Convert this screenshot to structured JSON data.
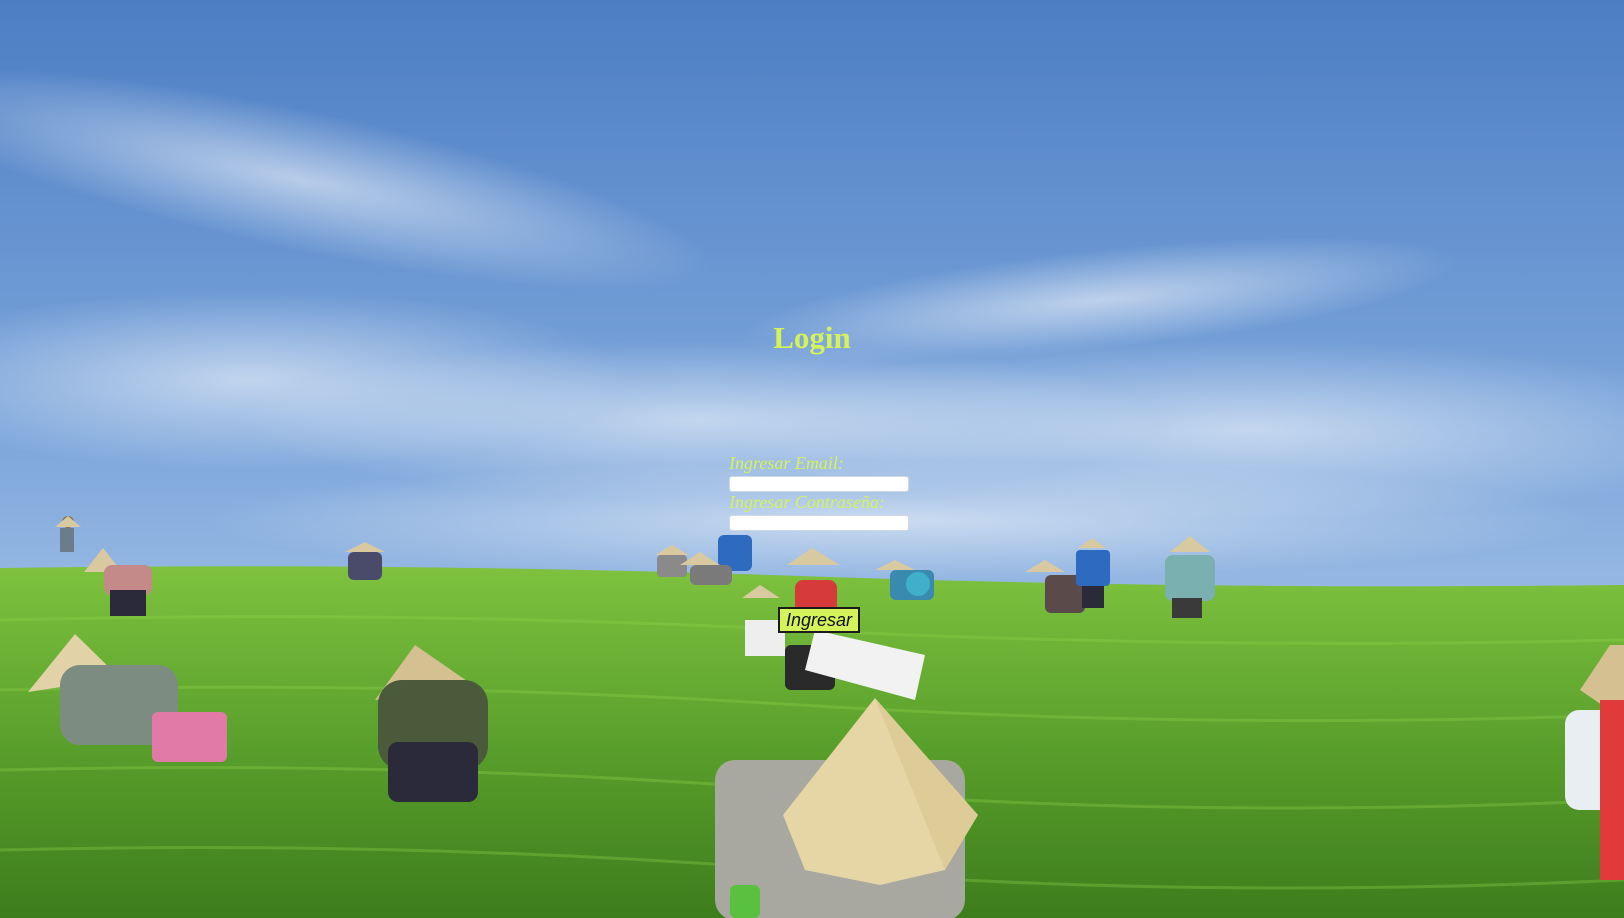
{
  "login": {
    "title": "Login",
    "email_label": "Ingresar Email:",
    "email_value": "",
    "password_label": "Ingresar Contraseña:",
    "password_value": "",
    "submit_label": "Ingresar"
  },
  "colors": {
    "accent": "#d4f25a",
    "sky_top": "#4c7dc4",
    "sky_horizon": "#c9dcf2",
    "field_green": "#5aa02c",
    "button_border": "#1a1a1a"
  },
  "background": {
    "description_icon": "tea-plantation-photo"
  }
}
